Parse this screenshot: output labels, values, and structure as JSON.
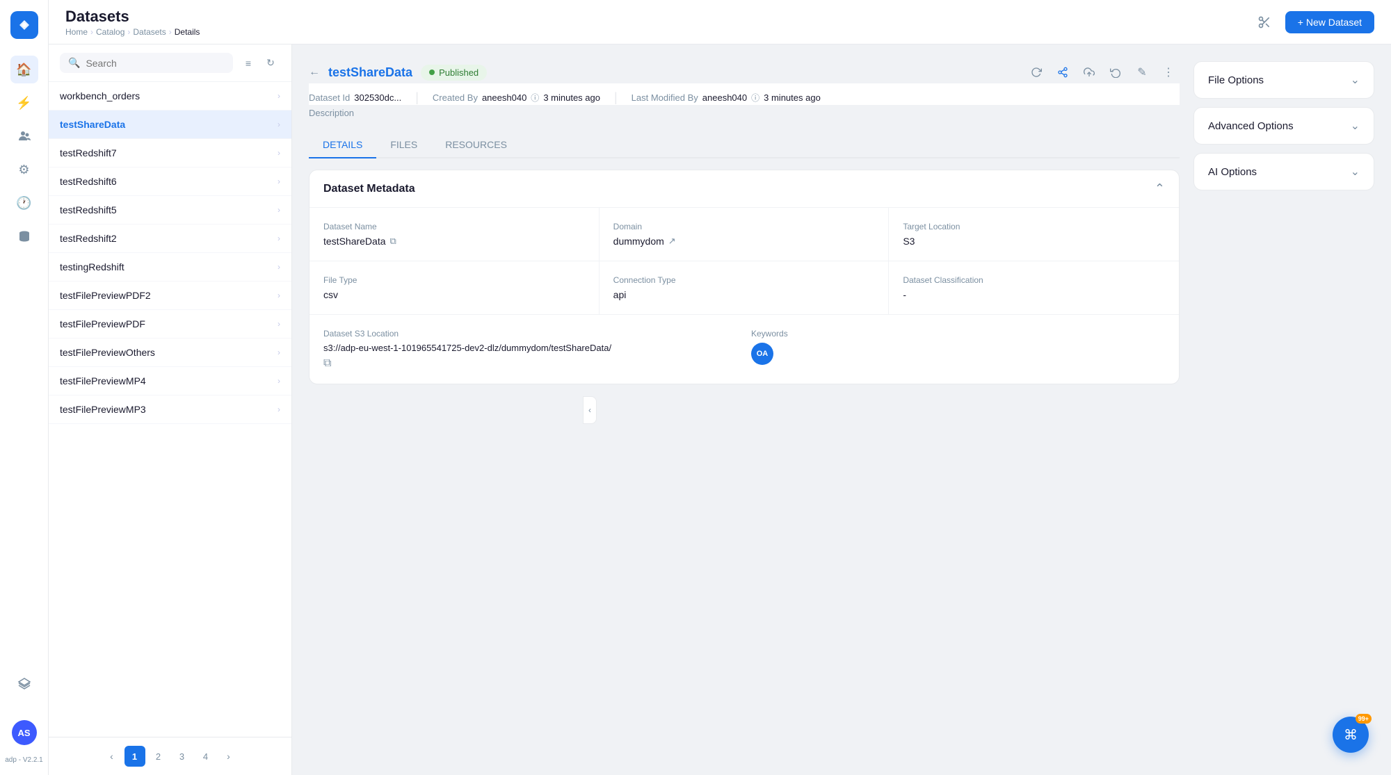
{
  "app": {
    "title": "Datasets",
    "version": "adp - V2.2.1"
  },
  "breadcrumb": {
    "items": [
      "Home",
      "Catalog",
      "Datasets",
      "Details"
    ],
    "separators": [
      ">",
      ">",
      ">"
    ]
  },
  "header": {
    "new_dataset_label": "+ New Dataset"
  },
  "sidebar": {
    "search_placeholder": "Search",
    "items": [
      {
        "name": "workbench_orders",
        "active": false
      },
      {
        "name": "testShareData",
        "active": true
      },
      {
        "name": "testRedshift7",
        "active": false
      },
      {
        "name": "testRedshift6",
        "active": false
      },
      {
        "name": "testRedshift5",
        "active": false
      },
      {
        "name": "testRedshift2",
        "active": false
      },
      {
        "name": "testingRedshift",
        "active": false
      },
      {
        "name": "testFilePreviewPDF2",
        "active": false
      },
      {
        "name": "testFilePreviewPDF",
        "active": false
      },
      {
        "name": "testFilePreviewOthers",
        "active": false
      },
      {
        "name": "testFilePreviewMP4",
        "active": false
      },
      {
        "name": "testFilePreviewMP3",
        "active": false
      }
    ],
    "pagination": {
      "pages": [
        "1",
        "2",
        "3",
        "4"
      ],
      "active_page": "1"
    }
  },
  "dataset": {
    "title": "testShareData",
    "status": "Published",
    "dataset_id_label": "Dataset Id",
    "dataset_id": "302530dc...",
    "created_by_label": "Created By",
    "created_by": "aneesh040",
    "created_time": "3 minutes ago",
    "modified_by_label": "Last Modified By",
    "modified_by": "aneesh040",
    "modified_time": "3 minutes ago",
    "description_label": "Description"
  },
  "tabs": {
    "items": [
      "DETAILS",
      "FILES",
      "RESOURCES"
    ],
    "active": "DETAILS"
  },
  "metadata_card": {
    "title": "Dataset Metadata",
    "fields": [
      {
        "label": "Dataset Name",
        "value": "testShareData",
        "has_copy": true
      },
      {
        "label": "Domain",
        "value": "dummydom",
        "has_external": true
      },
      {
        "label": "Target Location",
        "value": "S3"
      },
      {
        "label": "File Type",
        "value": "csv"
      },
      {
        "label": "Connection Type",
        "value": "api"
      },
      {
        "label": "Dataset Classification",
        "value": "-"
      }
    ],
    "s3_location_label": "Dataset S3 Location",
    "s3_location": "s3://adp-eu-west-1-101965541725-dev2-dlz/dummydom/testShareData/",
    "keywords_label": "Keywords",
    "keywords_avatar": "OA"
  },
  "right_panel": {
    "file_options_label": "File Options",
    "advanced_options_label": "Advanced Options",
    "ai_options_label": "AI Options"
  },
  "fab": {
    "badge": "99+"
  },
  "user": {
    "initials": "AS"
  },
  "icons": {
    "home": "⌂",
    "analytics": "⚡",
    "users": "👥",
    "settings": "⚙",
    "clock": "🕐",
    "database": "🗄",
    "search": "🔍",
    "filter": "≡",
    "refresh": "↻",
    "chevron_right": "›",
    "chevron_left": "‹",
    "chevron_down": "⌄",
    "chevron_up": "⌃",
    "share": "⬆",
    "edit": "✎",
    "more": "⋮",
    "copy": "⧉",
    "external": "↗",
    "collapse": "⌃",
    "scissors": "✂",
    "upload": "↑",
    "history": "↺",
    "info": "ⓘ",
    "shortcut": "⌘"
  }
}
